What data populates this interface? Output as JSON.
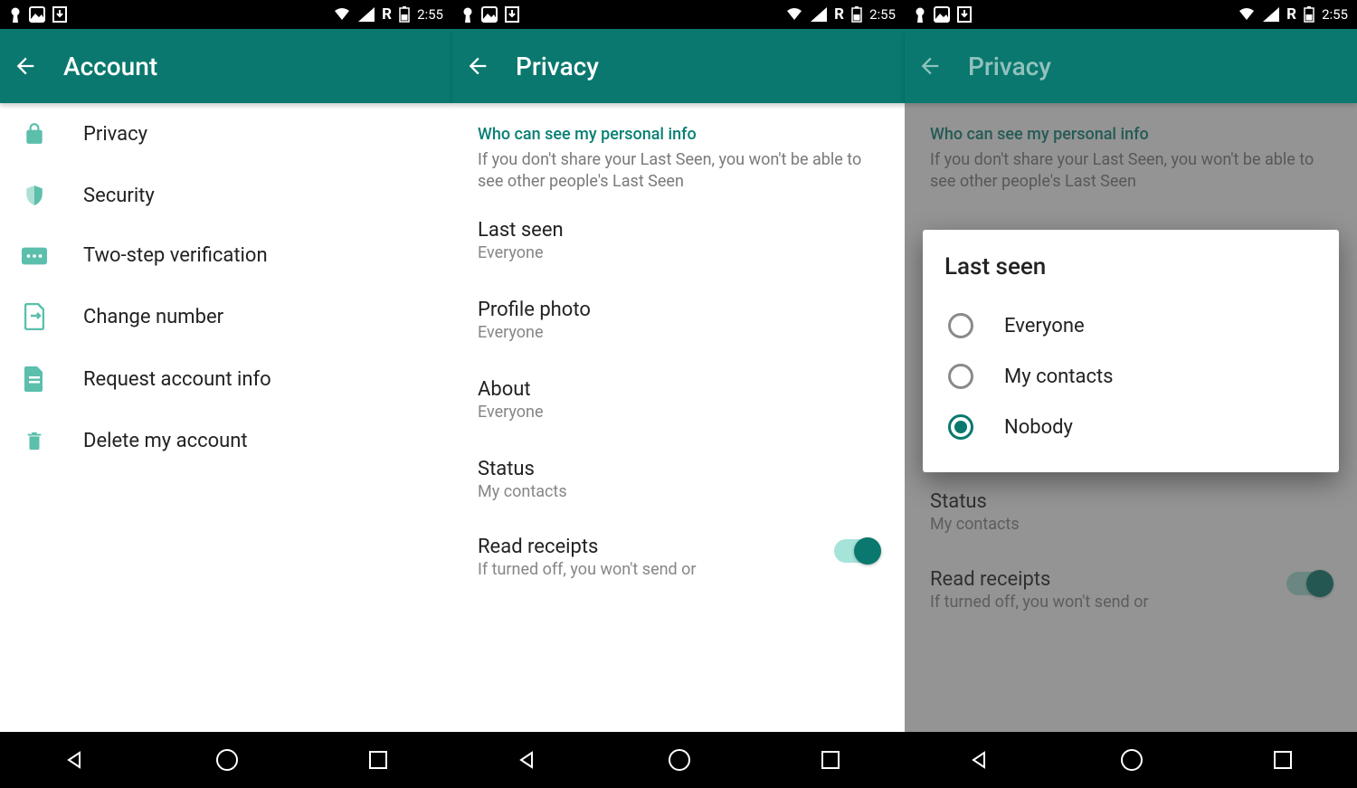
{
  "status_bar": {
    "time": "2:55",
    "roaming": "R"
  },
  "panel1": {
    "title": "Account",
    "items": [
      {
        "label": "Privacy",
        "icon": "lock-icon"
      },
      {
        "label": "Security",
        "icon": "shield-icon"
      },
      {
        "label": "Two-step verification",
        "icon": "password-icon"
      },
      {
        "label": "Change number",
        "icon": "sim-icon"
      },
      {
        "label": "Request account info",
        "icon": "document-icon"
      },
      {
        "label": "Delete my account",
        "icon": "trash-icon"
      }
    ]
  },
  "panel2": {
    "title": "Privacy",
    "section_header": "Who can see my personal info",
    "section_desc": "If you don't share your Last Seen, you won't be able to see other people's Last Seen",
    "settings": [
      {
        "title": "Last seen",
        "value": "Everyone"
      },
      {
        "title": "Profile photo",
        "value": "Everyone"
      },
      {
        "title": "About",
        "value": "Everyone"
      },
      {
        "title": "Status",
        "value": "My contacts"
      }
    ],
    "read_receipts": {
      "title": "Read receipts",
      "desc": "If turned off, you won't send or",
      "enabled": true
    }
  },
  "panel3": {
    "title": "Privacy",
    "section_header": "Who can see my personal info",
    "section_desc": "If you don't share your Last Seen, you won't be able to see other people's Last Seen",
    "visible_settings": [
      {
        "title": "Status",
        "value": "My contacts"
      }
    ],
    "read_receipts": {
      "title": "Read receipts",
      "desc": "If turned off, you won't send or",
      "enabled": true
    },
    "dialog": {
      "title": "Last seen",
      "options": [
        {
          "label": "Everyone",
          "selected": false
        },
        {
          "label": "My contacts",
          "selected": false
        },
        {
          "label": "Nobody",
          "selected": true
        }
      ]
    }
  }
}
